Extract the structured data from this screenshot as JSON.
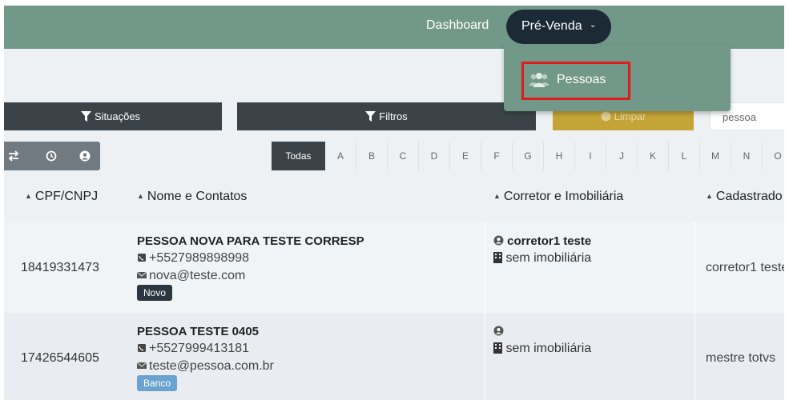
{
  "nav": {
    "dashboard": "Dashboard",
    "pre_venda": "Pré-Venda",
    "dropdown_item": "Pessoas"
  },
  "toolbar": {
    "situacoes": "Situações",
    "filtros": "Filtros",
    "limpar": "Limpar",
    "search_value": "pessoa"
  },
  "letters": [
    "Todas",
    "A",
    "B",
    "C",
    "D",
    "E",
    "F",
    "G",
    "H",
    "I",
    "J",
    "K",
    "L",
    "M",
    "N",
    "O"
  ],
  "columns": {
    "cpf": "CPF/CNPJ",
    "nome": "Nome e Contatos",
    "corretor": "Corretor e Imobiliária",
    "cadastrado": "Cadastrado"
  },
  "rows": [
    {
      "cpf": "18419331473",
      "name": "PESSOA NOVA PARA TESTE CORRESP",
      "phone": "+5527989898998",
      "email": "nova@teste.com",
      "badge": "Novo",
      "corretor": "corretor1 teste",
      "imobiliaria": "sem imobiliária",
      "cadastrado": "corretor1 teste"
    },
    {
      "cpf": "17426544605",
      "name": "PESSOA TESTE 0405",
      "phone": "+5527999413181",
      "email": "teste@pessoa.com.br",
      "badge": "Banco",
      "corretor": "",
      "imobiliaria": "sem imobiliária",
      "cadastrado": "mestre totvs"
    }
  ],
  "colors": {
    "topbar": "#729889",
    "nav_pill": "#1c2a36",
    "dark_button": "#3c4348",
    "limpar_button": "#c5a437",
    "highlight_border": "#e01b1b",
    "badge_novo": "#2b3640",
    "badge_banco": "#6aa3cf"
  },
  "icons": {
    "filter": "filter-icon",
    "people": "people-icon",
    "phone": "phone-icon",
    "email": "envelope-icon",
    "user": "user-circle-icon",
    "building": "building-icon",
    "chevron": "chevron-down-icon"
  }
}
